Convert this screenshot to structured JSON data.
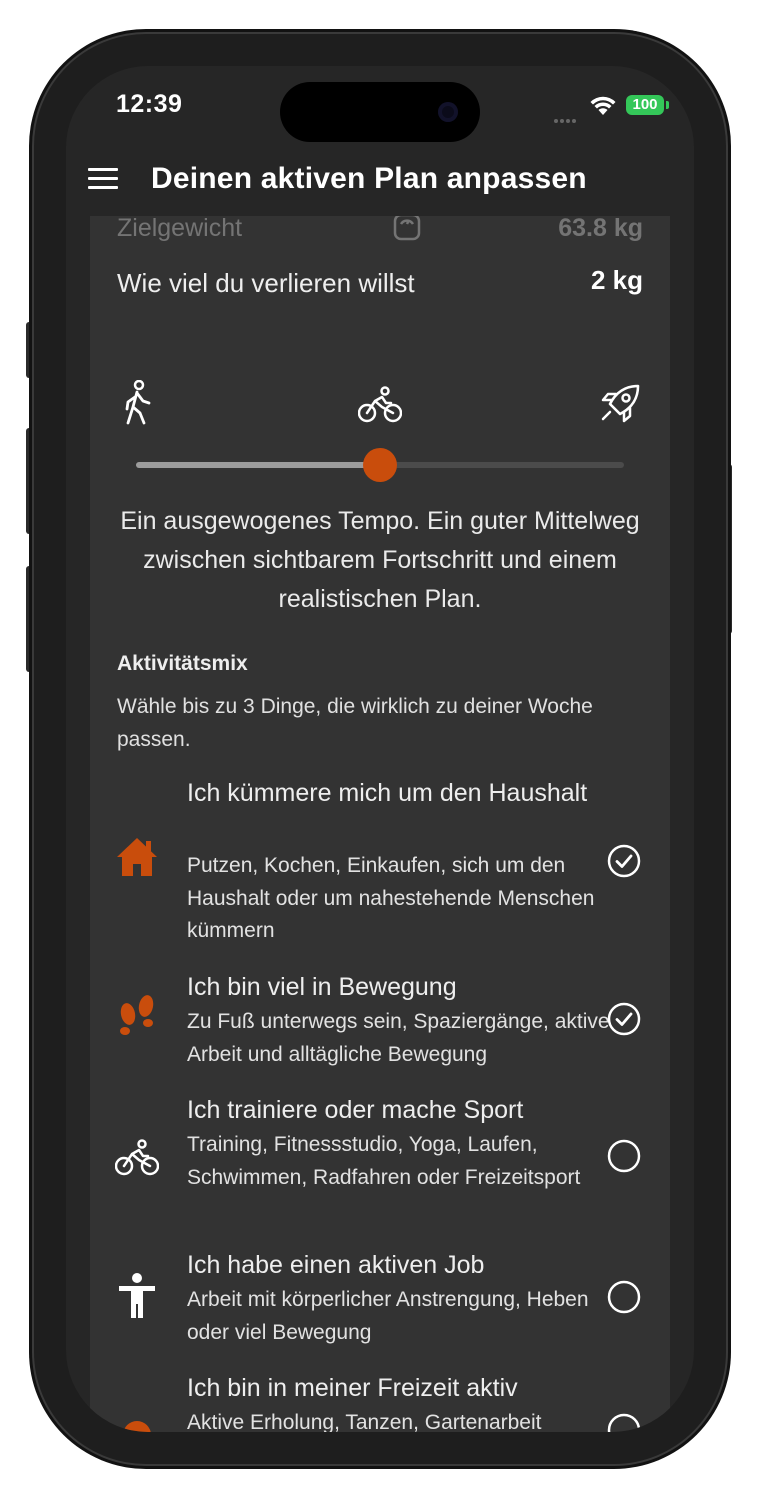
{
  "status_bar": {
    "time": "12:39",
    "battery": "100",
    "battery_color": "#34c759"
  },
  "app_bar": {
    "menu_icon": "hamburger-menu-icon",
    "title": "Deinen aktiven Plan anpassen"
  },
  "plan": {
    "target_weight_label": "Zielgewicht",
    "target_weight_value": "63.8 kg",
    "lose_label": "Wie viel du verlieren willst",
    "lose_value": "2 kg",
    "pace": {
      "icons": [
        "walking-icon",
        "bicycle-icon",
        "rocket-icon"
      ],
      "level": 0.5,
      "description": "Ein ausgewogenes Tempo. Ein guter Mittelweg zwischen sichtbarem Fortschritt und einem realistischen Plan."
    }
  },
  "activity_mix": {
    "title": "Aktivitätsmix",
    "description": "Wähle bis zu 3 Dinge, die wirklich zu deiner Woche passen.",
    "accent_color": "#c94d0c",
    "items": [
      {
        "icon": "house-icon",
        "title": "Ich kümmere mich um den Haushalt",
        "description": "Putzen, Kochen, Einkaufen, sich um den Haushalt oder um nahestehende Menschen kümmern",
        "selected": true
      },
      {
        "icon": "footprints-icon",
        "title": "Ich bin viel in Bewegung",
        "description": "Zu Fuß unterwegs sein, Spaziergänge, aktive Arbeit und alltägliche Bewegung",
        "selected": true
      },
      {
        "icon": "bicycle-icon",
        "title": "Ich trainiere oder mache Sport",
        "description": "Training, Fitnessstudio, Yoga, Laufen, Schwimmen, Radfahren oder Freizeitsport",
        "selected": false
      },
      {
        "icon": "person-standing-icon",
        "title": "Ich habe einen aktiven Job",
        "description": "Arbeit mit körperlicher Anstrengung, Heben oder viel Bewegung",
        "selected": false
      },
      {
        "icon": "leisure-icon",
        "title": "Ich bin in meiner Freizeit aktiv",
        "description": "Aktive Erholung, Tanzen, Gartenarbeit",
        "selected": false
      }
    ]
  }
}
